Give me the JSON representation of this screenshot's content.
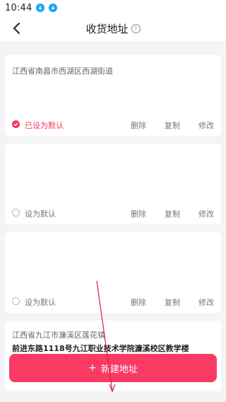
{
  "status_bar": {
    "time": "10:44",
    "icons": [
      "download-icon",
      "download-icon"
    ]
  },
  "header": {
    "title": "收货地址",
    "help_icon": "question-circle-icon",
    "back_icon": "chevron-left-icon"
  },
  "addresses": [
    {
      "line1": "江西省南昌市西湖区西湖街道",
      "line2": "",
      "is_default": true,
      "default_label": "已设为默认",
      "actions": {
        "delete": "删除",
        "copy": "复制",
        "edit": "修改"
      }
    },
    {
      "line1": "",
      "line2": "",
      "is_default": false,
      "default_label": "设为默认",
      "actions": {
        "delete": "删除",
        "copy": "复制",
        "edit": "修改"
      }
    },
    {
      "line1": "",
      "line2": "",
      "is_default": false,
      "default_label": "设为默认",
      "actions": {
        "delete": "删除",
        "copy": "复制",
        "edit": "修改"
      }
    },
    {
      "line1": "江西省九江市濂溪区莲花镇",
      "line2": "前进东路1118号九江职业技术学院濂溪校区教学楼",
      "is_default": false,
      "default_label": "",
      "actions": {}
    }
  ],
  "new_address_button": {
    "label": "新建地址",
    "icon": "plus-icon"
  },
  "colors": {
    "accent": "#fb3a66",
    "default_active": "#f23a5f",
    "annotation_arrow": "#d9233a"
  }
}
